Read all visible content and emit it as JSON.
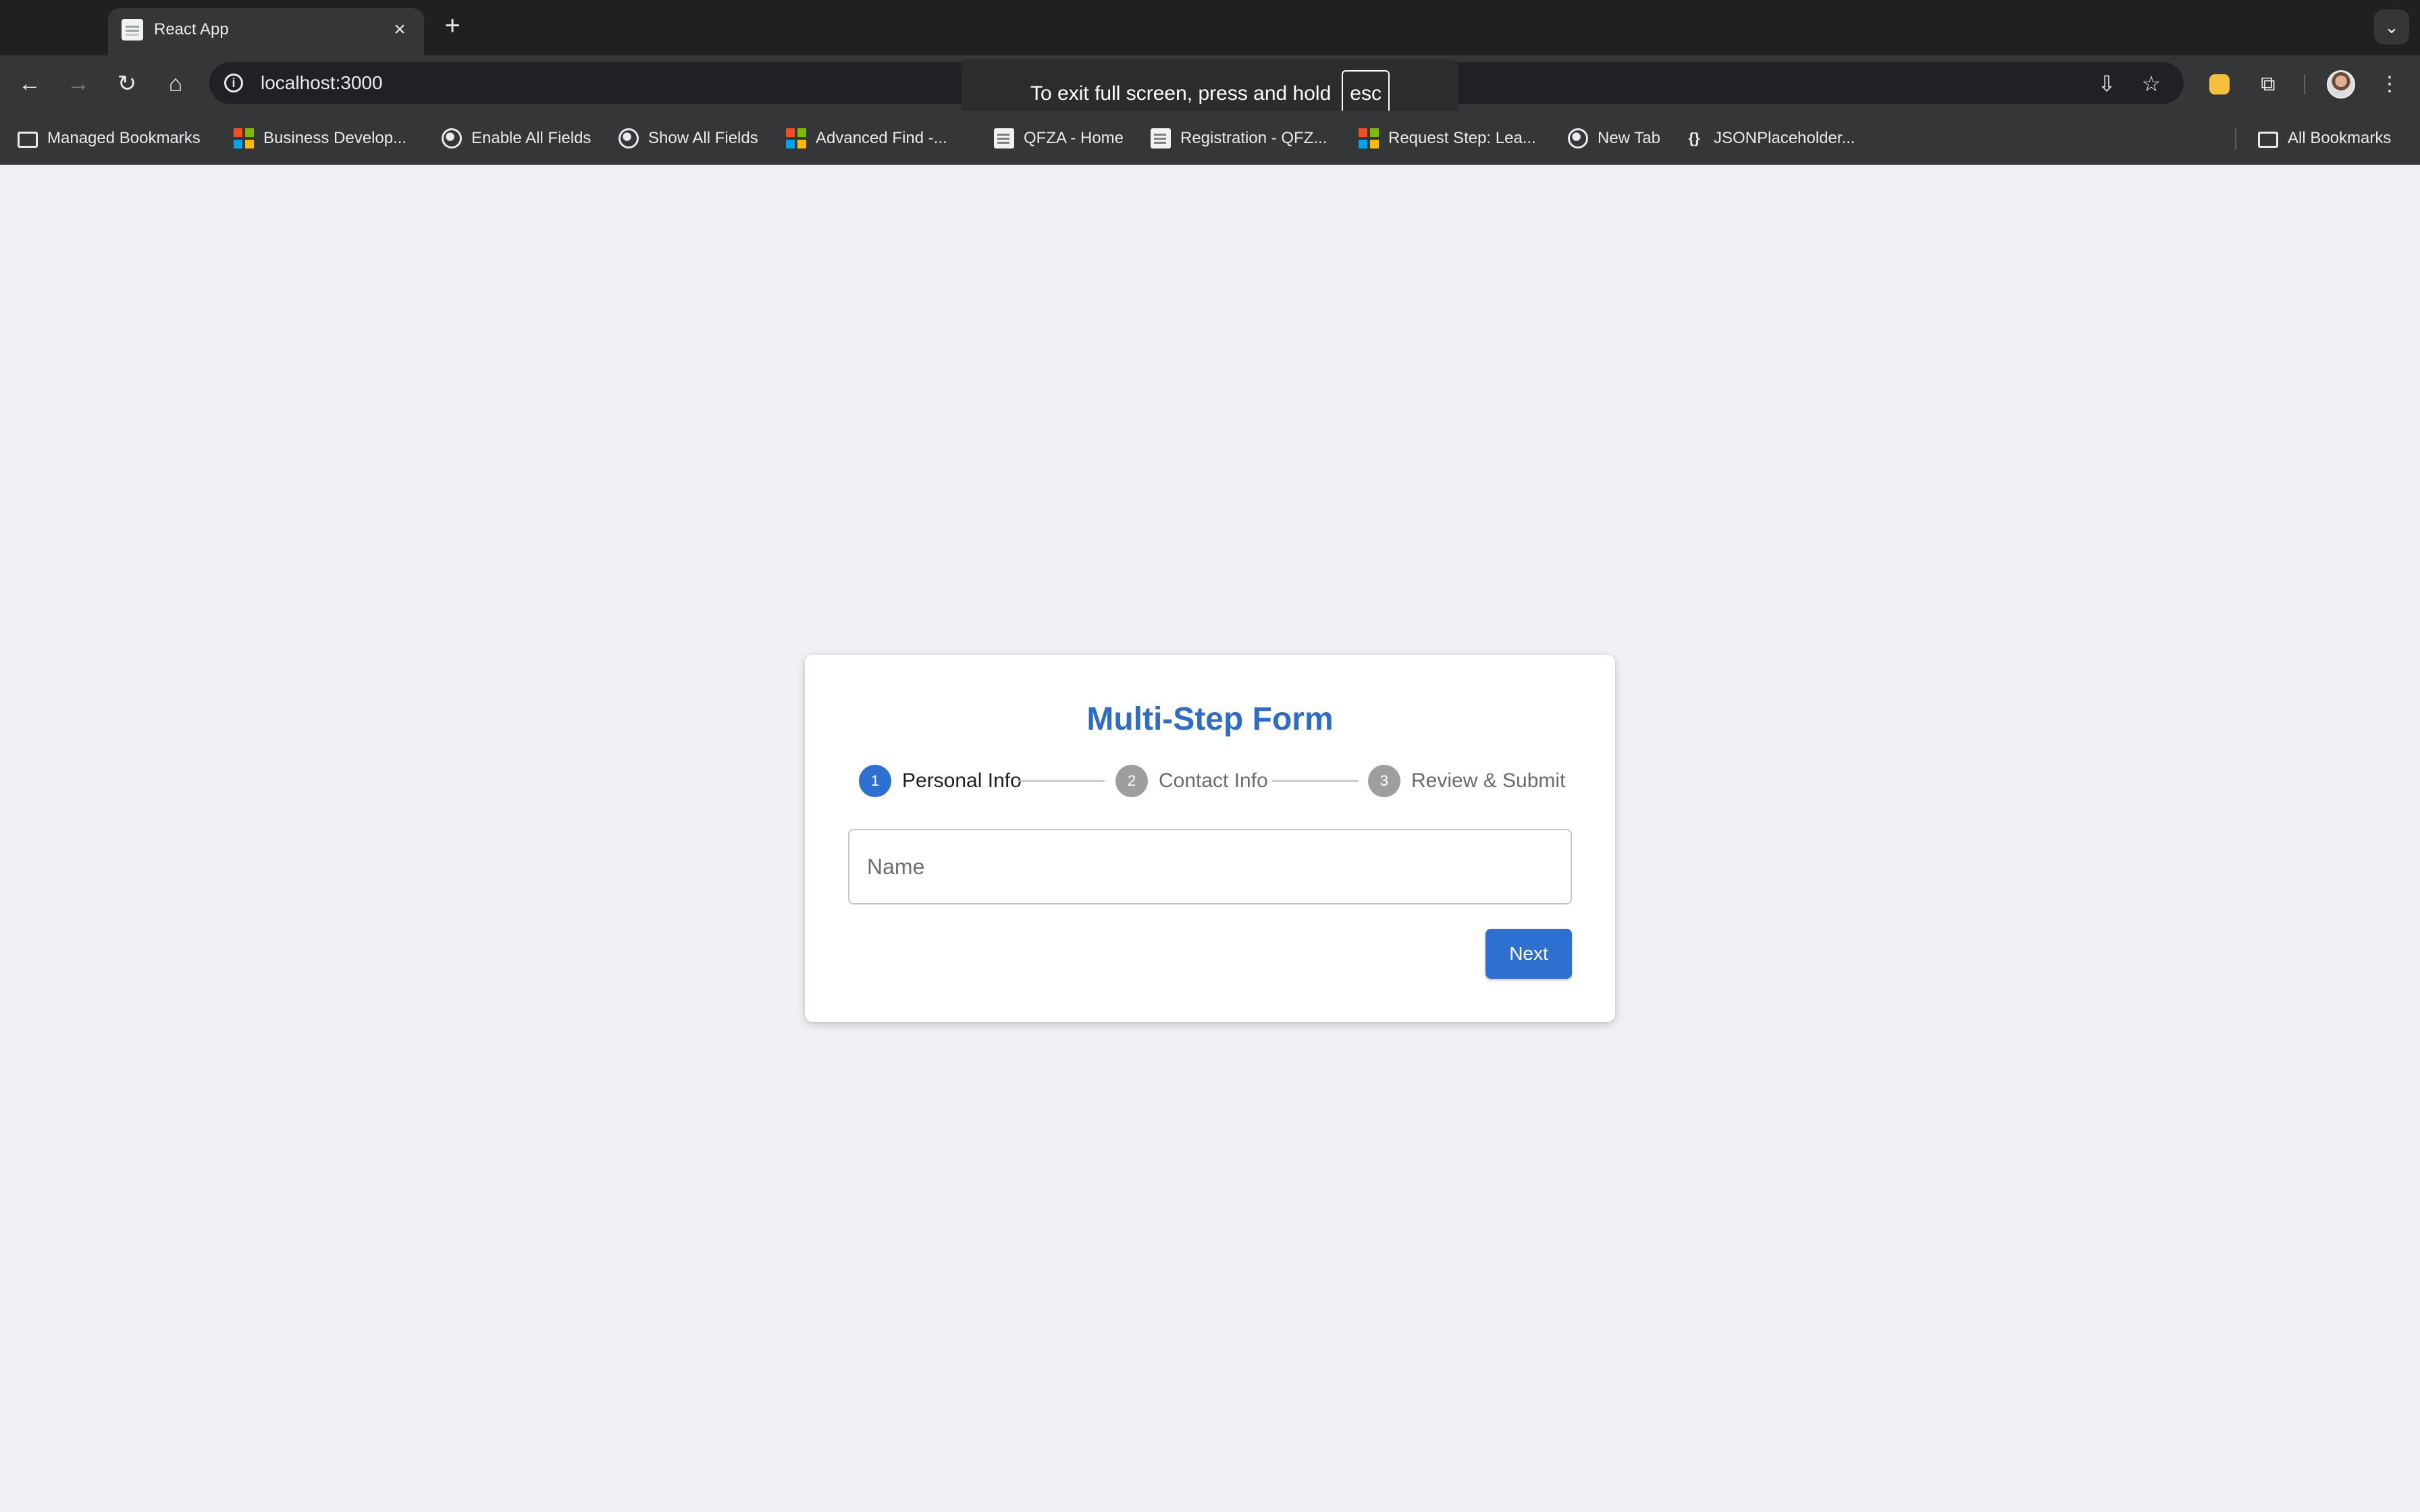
{
  "browser": {
    "tab": {
      "title": "React App",
      "close_symbol": "×",
      "favicon": "react-app-favicon"
    },
    "new_tab_symbol": "+",
    "tab_search_symbol": "⌄",
    "address": "localhost:3000",
    "info_symbol": "i",
    "fullscreen_toast": {
      "text": "To exit full screen, press and hold",
      "key": "esc"
    },
    "bookmarks": [
      {
        "label": "Managed Bookmarks",
        "icon": "folder-managed-icon"
      },
      {
        "label": "Business Develop...",
        "icon": "microsoft-icon"
      },
      {
        "label": "Enable All Fields",
        "icon": "globe-icon"
      },
      {
        "label": "Show All Fields",
        "icon": "globe-icon"
      },
      {
        "label": "Advanced Find -...",
        "icon": "microsoft-icon"
      },
      {
        "label": "QFZA - Home",
        "icon": "document-icon"
      },
      {
        "label": "Registration  - QFZ...",
        "icon": "document-icon"
      },
      {
        "label": "Request Step: Lea...",
        "icon": "microsoft-icon"
      },
      {
        "label": "New Tab",
        "icon": "globe-icon"
      },
      {
        "label": "JSONPlaceholder...",
        "icon": "json-icon"
      }
    ],
    "all_bookmarks": "All Bookmarks"
  },
  "form": {
    "title": "Multi-Step Form",
    "steps": [
      {
        "number": "1",
        "label": "Personal Info",
        "state": "active"
      },
      {
        "number": "2",
        "label": "Contact Info",
        "state": "inactive"
      },
      {
        "number": "3",
        "label": "Review & Submit",
        "state": "inactive"
      }
    ],
    "name_field": {
      "value": "",
      "placeholder": "Name"
    },
    "next_label": "Next"
  },
  "colors": {
    "accent": "#2e70cf",
    "title": "#2f6cc3",
    "inactive_step": "#9e9e9e",
    "page_bg": "#f0f1f5",
    "chrome_dark": "#1f2021",
    "chrome_toolbar": "#353637"
  }
}
